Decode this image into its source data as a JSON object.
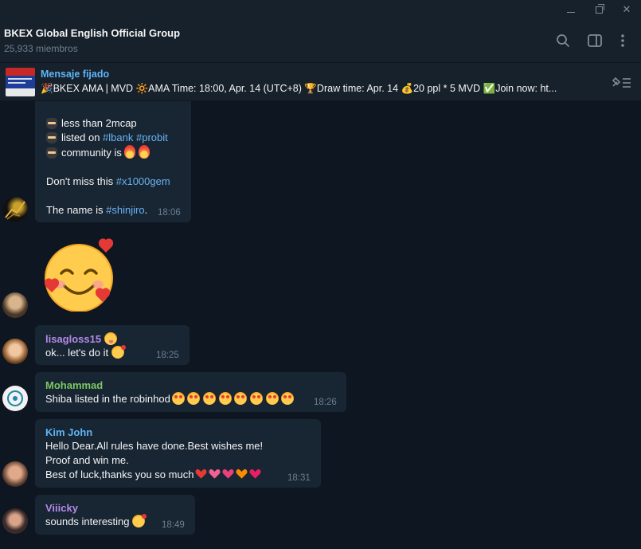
{
  "window": {
    "minimize_icon": "minimize-icon",
    "maximize_icon": "restore-icon",
    "close_icon": "close-icon",
    "close_glyph": "✕"
  },
  "header": {
    "title": "BKEX Global English Official Group",
    "subtitle": "25,933 miembros",
    "icons": [
      "search-icon",
      "sidebar-toggle-icon",
      "more-vertical-icon"
    ]
  },
  "pinned": {
    "label": "Mensaje fijado",
    "text": "🎉BKEX AMA | MVD 🔆AMA Time: 18:00, Apr. 14 (UTC+8) 🏆Draw time: Apr. 14 💰20 ppl * 5 MVD ✅Join now: ht...",
    "icon": "unpin-list-icon"
  },
  "messages": [
    {
      "id": "msg1",
      "lines": [
        {
          "emoji": "ninja",
          "text": "less than 2mcap"
        },
        {
          "emoji": "ninja",
          "text_before": "listed on ",
          "tags": [
            "#lbank",
            "#probit"
          ]
        },
        {
          "emoji": "ninja",
          "text": "community is ",
          "trail": "fire fire"
        },
        {
          "text_before": "Don't miss this ",
          "tag": "#x1000gem"
        },
        {
          "text_before": "The name is ",
          "tag": "#shinjiro",
          "text_after": "."
        }
      ],
      "time": "18:06"
    },
    {
      "id": "msg2",
      "sticker": "smiling-face-with-hearts"
    },
    {
      "id": "msg3",
      "sender": "lisagloss15",
      "sender_color": "#b38ae8",
      "text": "ok... let's do it",
      "time": "18:25"
    },
    {
      "id": "msg4",
      "sender": "Mohammad",
      "sender_color": "#7bc862",
      "text": "Shiba listed in the robinhod",
      "time": "18:26"
    },
    {
      "id": "msg5",
      "sender": "Kim John",
      "sender_color": "#5eb5f7",
      "lines": [
        "Hello Dear.All rules have done.Best wishes me!",
        "Proof and win me.",
        "Best of luck,thanks you so much"
      ],
      "time": "18:31"
    },
    {
      "id": "msg6",
      "sender": "Viiicky",
      "sender_color": "#b38ae8",
      "text": "sounds interesting",
      "time": "18:49"
    }
  ]
}
